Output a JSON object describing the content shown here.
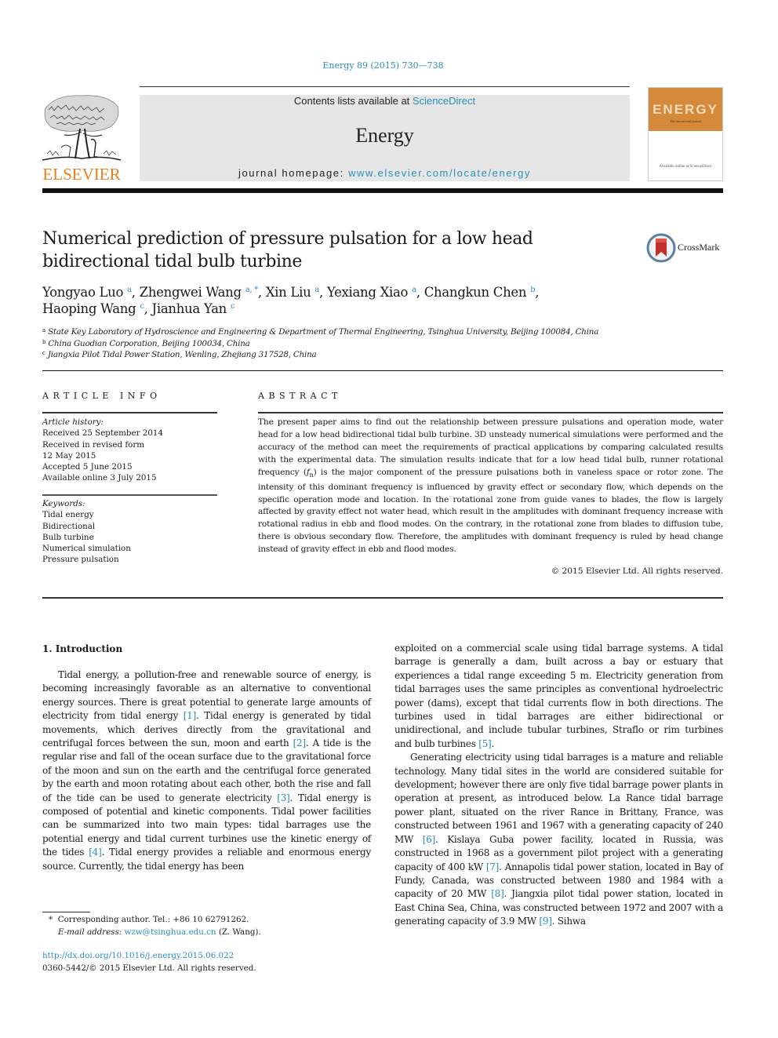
{
  "journal_ref": "Energy 89 (2015) 730—738",
  "masthead": {
    "contents_prefix": "Contents lists available at ",
    "contents_link": "ScienceDirect",
    "journal_name": "Energy",
    "homepage_prefix": "journal homepage: ",
    "homepage_link": "www.elsevier.com/locate/energy"
  },
  "publisher": {
    "logo_word": "ELSEVIER",
    "brand_color": "#f07d19"
  },
  "cover": {
    "title": "ENERGY",
    "subtitle": "The international journal",
    "footer": "Available online at ScienceDirect"
  },
  "crossmark": {
    "label": "CrossMark"
  },
  "article": {
    "title": "Numerical prediction of pressure pulsation for a low head bidirectional tidal bulb turbine",
    "authors": [
      {
        "name": "Yongyao Luo",
        "aff": "a"
      },
      {
        "name": "Zhengwei Wang",
        "aff": "a, *"
      },
      {
        "name": "Xin Liu",
        "aff": "a"
      },
      {
        "name": "Yexiang Xiao",
        "aff": "a"
      },
      {
        "name": "Changkun Chen",
        "aff": "b"
      },
      {
        "name": "Haoping Wang",
        "aff": "c"
      },
      {
        "name": "Jianhua Yan",
        "aff": "c"
      }
    ],
    "affiliations": [
      {
        "key": "a",
        "text": "State Key Laboratory of Hydroscience and Engineering & Department of Thermal Engineering, Tsinghua University, Beijing 100084, China"
      },
      {
        "key": "b",
        "text": "China Guodian Corporation, Beijing 100034, China"
      },
      {
        "key": "c",
        "text": "Jiangxia Pilot Tidal Power Station, Wenling, Zhejiang 317528, China"
      }
    ]
  },
  "article_info": {
    "heading": "ARTICLE INFO",
    "history_label": "Article history:",
    "history": [
      "Received 25 September 2014",
      "Received in revised form",
      "12 May 2015",
      "Accepted 5 June 2015",
      "Available online 3 July 2015"
    ],
    "keywords_label": "Keywords:",
    "keywords": [
      "Tidal energy",
      "Bidirectional",
      "Bulb turbine",
      "Numerical simulation",
      "Pressure pulsation"
    ]
  },
  "abstract": {
    "heading": "ABSTRACT",
    "text_before_symbol": "The present paper aims to find out the relationship between pressure pulsations and operation mode, water head for a low head bidirectional tidal bulb turbine. 3D unsteady numerical simulations were performed and the accuracy of the method can meet the requirements of practical applications by comparing calculated results with the experimental data. The simulation results indicate that for a low head tidal bulb, runner rotational frequency (",
    "symbol_base": "f",
    "symbol_sub": "n",
    "text_after_symbol": ") is the major component of the pressure pulsations both in vaneless space or rotor zone. The intensity of this dominant frequency is influenced by gravity effect or secondary flow, which depends on the specific operation mode and location. In the rotational zone from guide vanes to blades, the flow is largely affected by gravity effect not water head, which result in the amplitudes with dominant frequency increase with rotational radius in ebb and flood modes. On the contrary, in the rotational zone from blades to diffusion tube, there is obvious secondary flow. Therefore, the amplitudes with dominant frequency is ruled by head change instead of gravity effect in ebb and flood modes.",
    "copyright": "© 2015 Elsevier Ltd. All rights reserved."
  },
  "introduction": {
    "heading": "1.  Introduction",
    "left_column": [
      {
        "t": "Tidal energy, a pollution-free and renewable source of energy, is becoming increasingly favorable as an alternative to conventional energy sources. There is great potential to generate large amounts of electricity from tidal energy "
      },
      {
        "ref": "[1]"
      },
      {
        "t": ". Tidal energy is generated by tidal movements, which derives directly from the gravitational and centrifugal forces between the sun, moon and earth "
      },
      {
        "ref": "[2]"
      },
      {
        "t": ". A tide is the regular rise and fall of the ocean surface due to the gravitational force of the moon and sun on the earth and the centrifugal force generated by the earth and moon rotating about each other, both the rise and fall of the tide can be used to generate electricity "
      },
      {
        "ref": "[3]"
      },
      {
        "t": ". Tidal energy is composed of potential and kinetic components. Tidal power facilities can be summarized into two main types: tidal barrages use the potential energy and tidal current turbines use the kinetic energy of the tides "
      },
      {
        "ref": "[4]"
      },
      {
        "t": ". Tidal energy provides a reliable and enormous energy source. Currently, the tidal energy has been"
      }
    ],
    "right_column_p1": [
      {
        "t": "exploited on a commercial scale using tidal barrage systems. A tidal barrage is generally a dam, built across a bay or estuary that experiences a tidal range exceeding 5 m. Electricity generation from tidal barrages uses the same principles as conventional hydroelectric power (dams), except that tidal currents flow in both directions. The turbines used in tidal barrages are either bidirectional or unidirectional, and include tubular turbines, Straflo or rim turbines and bulb turbines "
      },
      {
        "ref": "[5]"
      },
      {
        "t": "."
      }
    ],
    "right_column_p2": [
      {
        "t": "Generating electricity using tidal barrages is a mature and reliable technology. Many tidal sites in the world are considered suitable for development; however there are only five tidal barrage power plants in operation at present, as introduced below. La Rance tidal barrage power plant, situated on the river Rance in Brittany, France, was constructed between 1961 and 1967 with a generating capacity of 240 MW "
      },
      {
        "ref": "[6]"
      },
      {
        "t": ". Kislaya Guba power facility, located in Russia, was constructed in 1968 as a government pilot project with a generating capacity of 400 kW "
      },
      {
        "ref": "[7]"
      },
      {
        "t": ". Annapolis tidal power station, located in Bay of Fundy, Canada, was constructed between 1980 and 1984 with a capacity of 20 MW "
      },
      {
        "ref": "[8]"
      },
      {
        "t": ". Jiangxia pilot tidal power station, located in East China Sea, China, was constructed between 1972 and 2007 with a generating capacity of 3.9 MW "
      },
      {
        "ref": "[9]"
      },
      {
        "t": ". Sihwa"
      }
    ]
  },
  "footnote": {
    "marker": "*",
    "corresponding": "Corresponding author. Tel.: +86 10 62791262.",
    "email_label": "E-mail address:",
    "email": "wzw@tsinghua.edu.cn",
    "email_suffix": " (Z. Wang)."
  },
  "doi": {
    "link": "http://dx.doi.org/10.1016/j.energy.2015.06.022",
    "issn_line": "0360-5442/© 2015 Elsevier Ltd. All rights reserved."
  },
  "colors": {
    "link": "#2a8fbd",
    "masthead_bg": "#e6e6e6",
    "cover_orange": "#d48a3a",
    "crossmark_red": "#c4302b"
  }
}
